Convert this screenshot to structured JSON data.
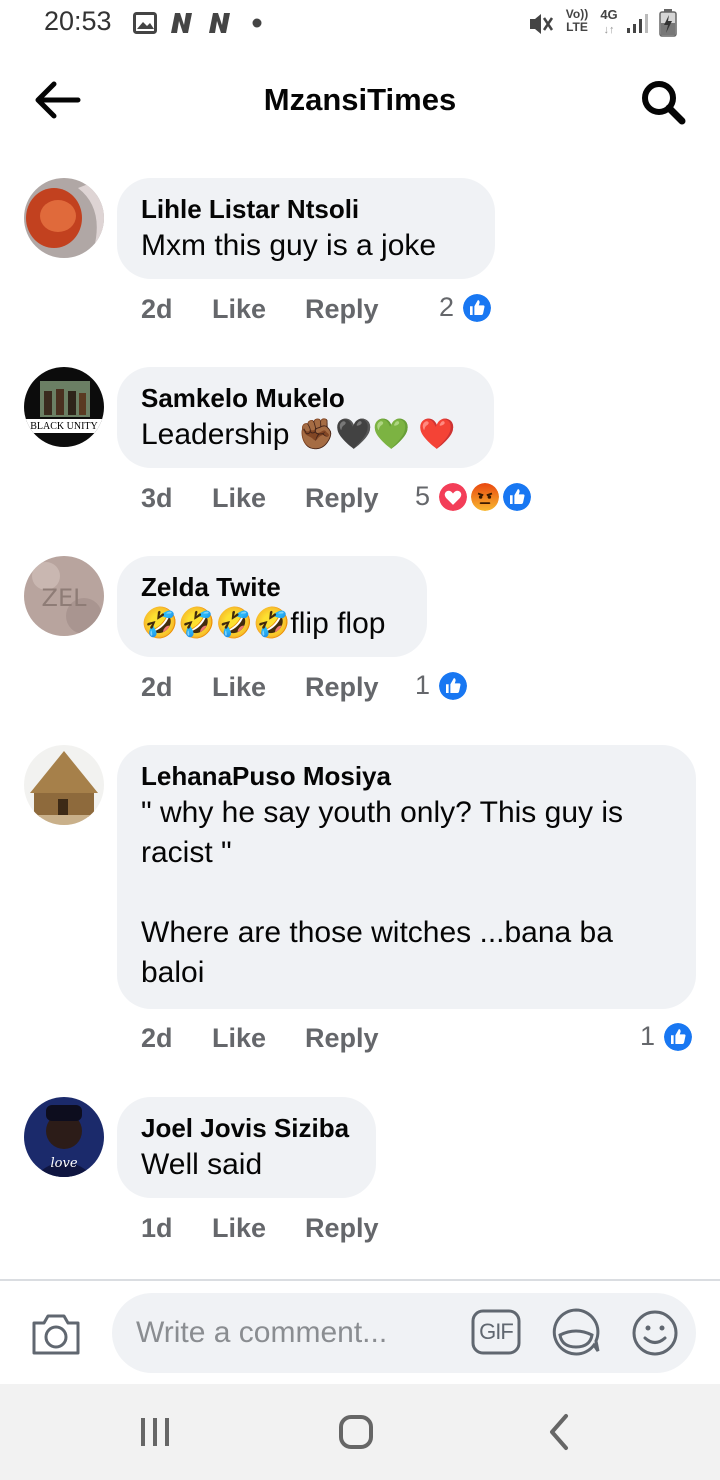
{
  "status_bar": {
    "time": "20:53",
    "icons": [
      "image-icon",
      "n-icon",
      "n-icon",
      "dot-icon",
      "mute-icon",
      "volte-icon",
      "4g-icon",
      "signal-icon",
      "battery-charging-icon"
    ],
    "volte_label_top": "Vo))",
    "volte_label_bottom": "LTE",
    "network_label": "4G"
  },
  "header": {
    "title": "MzansiTimes",
    "back_icon": "arrow-left-icon",
    "search_icon": "search-icon"
  },
  "comments": [
    {
      "author": "Lihle Listar Ntsoli",
      "text": "Mxm this guy is a joke",
      "time": "2d",
      "like": "Like",
      "reply": "Reply",
      "reaction_count": "2",
      "reactions": [
        "like"
      ]
    },
    {
      "author": "Samkelo Mukelo",
      "text": "Leadership ✊🏾🖤💚 ❤️",
      "avatar_text": "BLACK UNITY",
      "time": "3d",
      "like": "Like",
      "reply": "Reply",
      "reaction_count": "5",
      "reactions": [
        "love",
        "angry",
        "like"
      ]
    },
    {
      "author": "Zelda Twite",
      "text": "🤣🤣🤣🤣flip flop",
      "avatar_text": "ZEL",
      "time": "2d",
      "like": "Like",
      "reply": "Reply",
      "reaction_count": "1",
      "reactions": [
        "like"
      ]
    },
    {
      "author": "LehanaPuso Mosiya",
      "text": "\" why he say youth only? This guy is\nracist \"\n\nWhere are those witches ...bana ba\nbaloi",
      "time": "2d",
      "like": "Like",
      "reply": "Reply",
      "reaction_count": "1",
      "reactions": [
        "like"
      ]
    },
    {
      "author": "Joel Jovis Siziba",
      "text": "Well said",
      "avatar_text": "love",
      "time": "1d",
      "like": "Like",
      "reply": "Reply",
      "reaction_count": "",
      "reactions": []
    }
  ],
  "composer": {
    "placeholder": "Write a comment...",
    "camera_icon": "camera-icon",
    "gif_label": "GIF",
    "sticker_icon": "sticker-icon",
    "emoji_icon": "smiley-icon"
  },
  "nav_bar": {
    "buttons": [
      "recent-apps-icon",
      "home-icon",
      "back-icon"
    ]
  },
  "colors": {
    "bubble": "#f0f2f5",
    "meta": "#65676b",
    "like_blue": "#1877f2",
    "love_red": "#f33e58",
    "angry_orange": "#e9710f"
  }
}
